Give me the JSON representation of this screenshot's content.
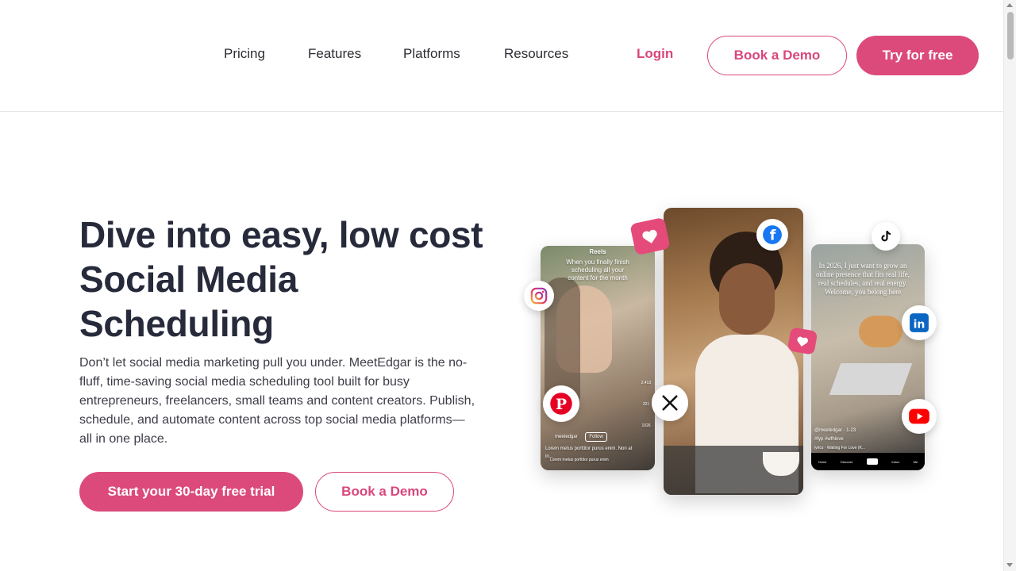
{
  "nav": {
    "links": [
      "Pricing",
      "Features",
      "Platforms",
      "Resources"
    ],
    "login": "Login",
    "book_demo": "Book a Demo",
    "try_free": "Try for free"
  },
  "hero": {
    "headline": "Dive into easy, low cost Social Media Scheduling",
    "description": "Don’t let social media marketing pull you under. MeetEdgar is the no-fluff, time-saving social media scheduling tool built for busy entrepreneurs, freelancers, small teams and content creators. Publish, schedule, and automate content across top social media platforms—all in one place.",
    "cta_primary": "Start your 30-day free trial",
    "cta_secondary": "Book a Demo"
  },
  "phones": {
    "left": {
      "top_label": "Reels",
      "caption": "When you finally finish scheduling all your content for the month",
      "handle": "meetedgar",
      "follow": "Follow",
      "post_text": "Lorem metus porttitor purus enim. Non at in...",
      "audio_text": "Lorem metus porttitor purus enim",
      "counts": [
        "2,413",
        "321",
        "1026"
      ]
    },
    "right": {
      "caption": "In 2026, I just want to grow an online presence that fits real life, real schedules, and real energy. Welcome, you belong here",
      "handle": "@meetedgar · 1-23",
      "tag": "#fyp #wfhlove",
      "audio_text": "lyrics · Waiting For Love (K...",
      "nav_labels": [
        "Home",
        "Discover",
        "",
        "Inbox",
        "Me"
      ]
    }
  },
  "colors": {
    "accent": "#dc4a7c",
    "heading": "#262a3a"
  },
  "icons": [
    "instagram-icon",
    "pinterest-icon",
    "facebook-icon",
    "x-icon",
    "tiktok-icon",
    "linkedin-icon",
    "youtube-icon",
    "heart-icon"
  ]
}
